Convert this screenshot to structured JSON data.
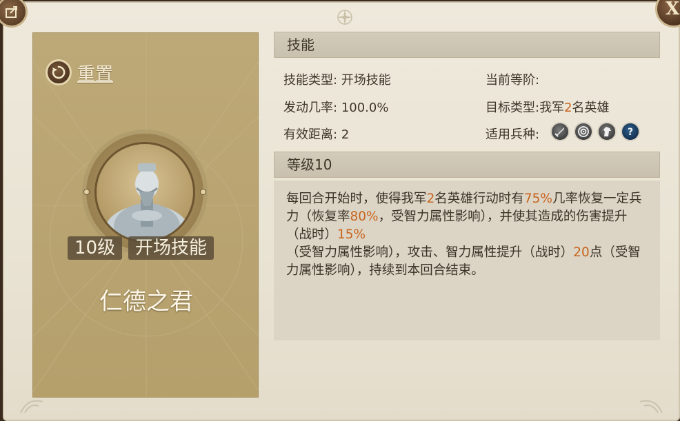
{
  "window": {
    "close_label": "X"
  },
  "left_panel": {
    "reset_label": "重置",
    "level_tag": "10级",
    "type_tag": "开场技能",
    "hero_name": "仁德之君"
  },
  "skill_section": {
    "header": "技能",
    "skill_type_label": "技能类型:",
    "skill_type_value": "开场技能",
    "current_rank_label": "当前等阶:",
    "current_rank_value": "",
    "trigger_rate_label": "发动几率:",
    "trigger_rate_value": "100.0%",
    "target_type_label": "目标类型:",
    "target_type_prefix": "我军",
    "target_type_count": "2",
    "target_type_suffix": "名英雄",
    "range_label": "有效距离:",
    "range_value": "2",
    "unit_types_label": "适用兵种:",
    "unit_types": [
      "sword-icon",
      "bow-target-icon",
      "horse-icon",
      "help-icon"
    ]
  },
  "level_section": {
    "header": "等级10",
    "desc_parts": [
      {
        "text": "每回合开始时，使得我军",
        "hl": false
      },
      {
        "text": "2",
        "hl": true
      },
      {
        "text": "名英雄行动时有",
        "hl": false
      },
      {
        "text": "75%",
        "hl": true
      },
      {
        "text": "几率恢复一定兵力（恢复率",
        "hl": false
      },
      {
        "text": "80%",
        "hl": true
      },
      {
        "text": "，受智力属性影响），并使其造成的伤害提升（战时）",
        "hl": false
      },
      {
        "text": "15%",
        "hl": true
      },
      {
        "text": "（受智力属性影响），攻击、智力属性提升（战时）",
        "hl": false
      },
      {
        "text": "20",
        "hl": true
      },
      {
        "text": "点（受智力属性影响），持续到本回合结束。",
        "hl": false
      }
    ]
  },
  "colors": {
    "highlight": "#c8631c",
    "panel_gold": "#b8a36f",
    "header_bg": "#cfc6b4"
  }
}
